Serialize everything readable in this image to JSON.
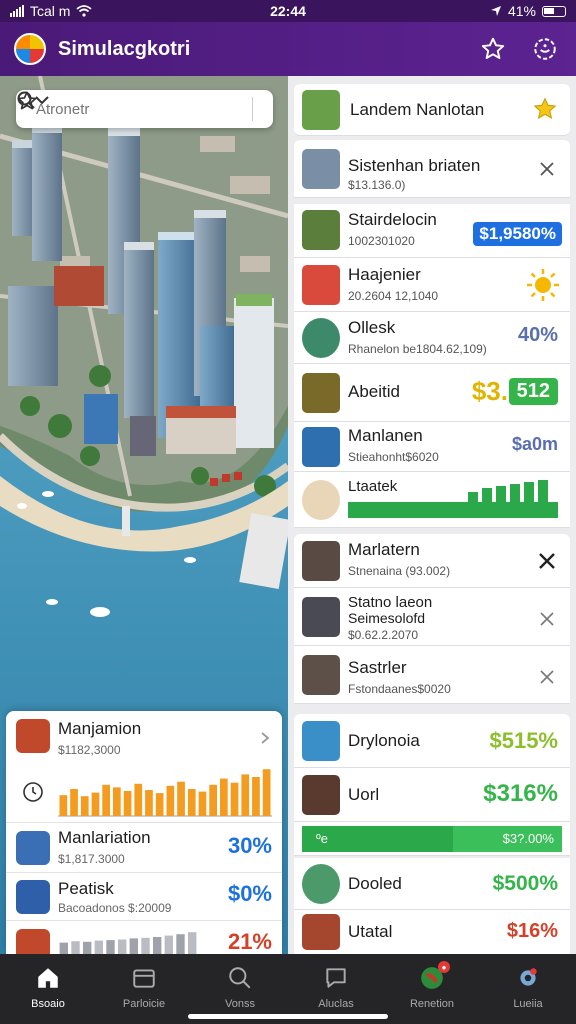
{
  "status_bar": {
    "carrier": "Tcal m",
    "time": "22:44",
    "battery": "41%"
  },
  "app": {
    "title": "Simulacgkotri"
  },
  "search": {
    "placeholder": "Atronetr"
  },
  "left_panel": {
    "items": [
      {
        "name": "Manjamion",
        "sub": "$1182,3000"
      },
      {
        "name": "Manlariation",
        "sub": "$1,817.3000",
        "value": "30%"
      },
      {
        "name": "Peatisk",
        "sub": "Bacoadonos $:20009",
        "value": "$0%"
      },
      {
        "name": "",
        "value": "21%"
      }
    ]
  },
  "list": {
    "items": [
      {
        "title": "Landem Nanlotan"
      },
      {
        "title": "Sistenhan briaten",
        "sub": "$13.136.0)"
      },
      {
        "title": "Stairdelocin",
        "sub": "1002301020",
        "value": "$1,9580%"
      },
      {
        "title": "Haajenier",
        "sub": "20.2604 12,1040"
      },
      {
        "title": "Ollesk",
        "sub": "Rhanelon be1804.62,109)",
        "value": "40%"
      },
      {
        "title": "Abeitid",
        "value": "$3.",
        "value2": "512"
      },
      {
        "title": "Manlanen",
        "sub": "Stieahonht$6020",
        "value": "$a0m"
      },
      {
        "title": "Ltaatek"
      },
      {
        "title": "Marlatern",
        "sub": "Stnenaina (93.002)"
      },
      {
        "title": "Statno laeon",
        "title2": "Seimesolofd",
        "sub": "$0.62.2.2070"
      },
      {
        "title": "Sastrler",
        "sub": "Fstondaanes$0020"
      },
      {
        "title": "Drylonoia",
        "value": "$515%"
      },
      {
        "title": "Uorl",
        "value": "$316%"
      },
      {
        "bar_left": "ºe",
        "bar_right": "$3?.00%"
      },
      {
        "title": "Dooled",
        "value": "$500%"
      },
      {
        "title": "Utatal",
        "value": "$16%"
      }
    ]
  },
  "tabs": [
    {
      "label": "Bsoaio"
    },
    {
      "label": "Parloicie"
    },
    {
      "label": "Vonss"
    },
    {
      "label": "Aluclas"
    },
    {
      "label": "Renetion"
    },
    {
      "label": "Lueiia"
    }
  ],
  "colors": {
    "header": "#4a1a78",
    "positive": "#35b44a",
    "accent_blue": "#1e6fe0",
    "accent_orange": "#f39c1f"
  },
  "chart_data": [
    {
      "type": "bar",
      "categories": [
        "1",
        "2",
        "3",
        "4",
        "5",
        "6",
        "7",
        "8",
        "9",
        "10",
        "11",
        "12",
        "13",
        "14",
        "15",
        "16",
        "17",
        "18",
        "19",
        "20"
      ],
      "values": [
        40,
        52,
        38,
        45,
        60,
        55,
        48,
        62,
        50,
        44,
        58,
        66,
        52,
        47,
        60,
        72,
        64,
        80,
        75,
        90
      ],
      "title": "",
      "xlabel": "",
      "ylabel": "",
      "ylim": [
        0,
        100
      ]
    },
    {
      "type": "bar",
      "categories": [
        "1",
        "2",
        "3",
        "4",
        "5",
        "6",
        "7",
        "8",
        "9",
        "10",
        "11",
        "12"
      ],
      "values": [
        55,
        60,
        58,
        62,
        64,
        66,
        70,
        72,
        75,
        80,
        85,
        92
      ],
      "title": "",
      "xlabel": "",
      "ylabel": "",
      "ylim": [
        0,
        100
      ]
    }
  ]
}
